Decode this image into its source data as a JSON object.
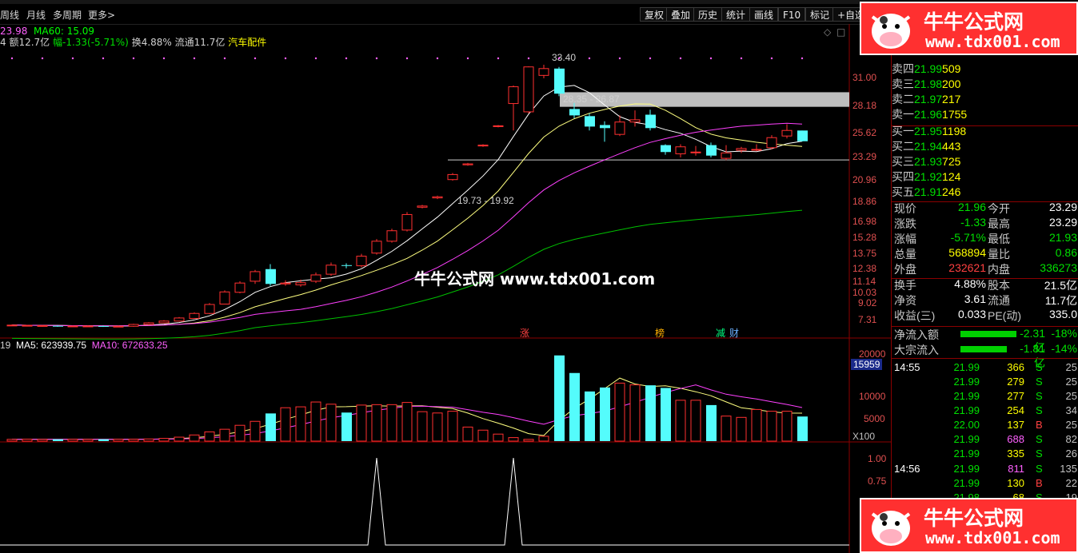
{
  "toolbar": {
    "left_items": [
      "周线",
      "月线",
      "多周期",
      "更多>"
    ],
    "buttons": [
      "复权",
      "叠加",
      "历史",
      "统计",
      "画线",
      "F10",
      "标记",
      "+自选"
    ]
  },
  "info": {
    "ma_values": [
      {
        "label": "23.98",
        "color": "#ff60ff"
      },
      {
        "label": "MA60: 15.09",
        "color": "#00ff00"
      }
    ],
    "line2": [
      {
        "text": "4 额12.7亿",
        "color": "#d0d0d0"
      },
      {
        "text": "幅-1.33(-5.71%)",
        "color": "#00e000"
      },
      {
        "text": "换4.88%",
        "color": "#d0d0d0"
      },
      {
        "text": "流通11.7亿",
        "color": "#d0d0d0"
      },
      {
        "text": "汽车配件",
        "color": "#ffff00"
      }
    ]
  },
  "price_axis": [
    "31.00",
    "28.18",
    "25.62",
    "23.29",
    "20.96",
    "18.86",
    "16.98",
    "15.28",
    "13.75",
    "12.38",
    "11.14",
    "10.03",
    "9.02",
    "7.31"
  ],
  "annotations": {
    "high": "33.40",
    "band1": "28.35 - 26.87",
    "band2": "19.73 - 19.92",
    "tags": [
      {
        "text": "涨",
        "color": "#ff4040"
      },
      {
        "text": "榜",
        "color": "#ffb000"
      },
      {
        "text": "减",
        "color": "#00ff80"
      },
      {
        "text": "财",
        "color": "#6ab0ff"
      }
    ]
  },
  "volume": {
    "header": [
      {
        "text": "19",
        "color": "#d0d0d0"
      },
      {
        "text": "MA5: 623939.75",
        "color": "#ffffff"
      },
      {
        "text": "MA10: 672633.25",
        "color": "#ff60ff"
      }
    ],
    "axis": [
      "20000",
      "15959",
      "10000",
      "5000",
      "X100"
    ],
    "highlight_value": "15959"
  },
  "indicator": {
    "axis": [
      "1.00",
      "0.75"
    ]
  },
  "watermark": {
    "center": "牛牛公式网 www.tdx001.com",
    "badge_title": "牛牛公式网",
    "badge_url": "www.tdx001.com"
  },
  "quote": {
    "asks": [
      {
        "label": "卖四",
        "price": "21.99",
        "vol": "509"
      },
      {
        "label": "卖三",
        "price": "21.98",
        "vol": "200"
      },
      {
        "label": "卖二",
        "price": "21.97",
        "vol": "217"
      },
      {
        "label": "卖一",
        "price": "21.96",
        "vol": "1755"
      }
    ],
    "bids": [
      {
        "label": "买一",
        "price": "21.95",
        "vol": "1198"
      },
      {
        "label": "买二",
        "price": "21.94",
        "vol": "443"
      },
      {
        "label": "买三",
        "price": "21.93",
        "vol": "725"
      },
      {
        "label": "买四",
        "price": "21.92",
        "vol": "124"
      },
      {
        "label": "买五",
        "price": "21.91",
        "vol": "246"
      }
    ],
    "stats": [
      {
        "l1": "现价",
        "v1": "21.96",
        "c1": "#00e000",
        "l2": "今开",
        "v2": "23.29",
        "c2": "#ffffff"
      },
      {
        "l1": "涨跌",
        "v1": "-1.33",
        "c1": "#00e000",
        "l2": "最高",
        "v2": "23.29",
        "c2": "#ffffff"
      },
      {
        "l1": "涨幅",
        "v1": "-5.71%",
        "c1": "#00e000",
        "l2": "最低",
        "v2": "21.93",
        "c2": "#00e000"
      },
      {
        "l1": "总量",
        "v1": "568894",
        "c1": "#ffff00",
        "l2": "量比",
        "v2": "0.86",
        "c2": "#00e000"
      },
      {
        "l1": "外盘",
        "v1": "232621",
        "c1": "#ff4040",
        "l2": "内盘",
        "v2": "336273",
        "c2": "#00e000"
      }
    ],
    "fund": [
      {
        "l1": "换手",
        "v1": "4.88%",
        "l2": "股本",
        "v2": "21.5亿"
      },
      {
        "l1": "净资",
        "v1": "3.61",
        "l2": "流通",
        "v2": "11.7亿"
      },
      {
        "l1": "收益(三)",
        "v1": "0.033",
        "l2": "PE(动)",
        "v2": "335.0"
      }
    ],
    "flows": [
      {
        "label": "净流入额",
        "value": "-2.31亿",
        "pct": "-18%"
      },
      {
        "label": "大宗流入",
        "value": "-1.81亿",
        "pct": "-14%"
      }
    ],
    "ticks": [
      {
        "time": "14:55",
        "price": "21.99",
        "vol": "366",
        "bs": "S",
        "n": "25",
        "pc": "#00e000",
        "vc": "#ffff00"
      },
      {
        "time": "",
        "price": "21.99",
        "vol": "279",
        "bs": "S",
        "n": "25",
        "pc": "#00e000",
        "vc": "#ffff00"
      },
      {
        "time": "",
        "price": "21.99",
        "vol": "277",
        "bs": "S",
        "n": "25",
        "pc": "#00e000",
        "vc": "#ffff00"
      },
      {
        "time": "",
        "price": "21.99",
        "vol": "254",
        "bs": "S",
        "n": "34",
        "pc": "#00e000",
        "vc": "#ffff00"
      },
      {
        "time": "",
        "price": "22.00",
        "vol": "137",
        "bs": "B",
        "n": "25",
        "pc": "#00e000",
        "vc": "#ffff00"
      },
      {
        "time": "",
        "price": "21.99",
        "vol": "688",
        "bs": "S",
        "n": "82",
        "pc": "#00e000",
        "vc": "#ff60ff"
      },
      {
        "time": "",
        "price": "21.99",
        "vol": "335",
        "bs": "S",
        "n": "26",
        "pc": "#00e000",
        "vc": "#ffff00"
      },
      {
        "time": "14:56",
        "price": "21.99",
        "vol": "811",
        "bs": "S",
        "n": "135",
        "pc": "#00e000",
        "vc": "#ff60ff"
      },
      {
        "time": "",
        "price": "21.99",
        "vol": "130",
        "bs": "B",
        "n": "22",
        "pc": "#00e000",
        "vc": "#ffff00"
      },
      {
        "time": "",
        "price": "21.98",
        "vol": "68",
        "bs": "S",
        "n": "19",
        "pc": "#00e000",
        "vc": "#ffff00"
      }
    ]
  },
  "chart_data": {
    "type": "candlestick",
    "price_scale": "log",
    "ylim": [
      7.31,
      33.4
    ],
    "candles": [
      [
        8.02,
        8.02,
        8.05,
        7.99
      ],
      [
        8.0,
        8.01,
        8.03,
        7.97
      ],
      [
        7.98,
        8.0,
        8.02,
        7.95
      ],
      [
        7.99,
        7.98,
        8.01,
        7.95
      ],
      [
        7.97,
        7.98,
        8.0,
        7.94
      ],
      [
        7.98,
        7.98,
        8.01,
        7.95
      ],
      [
        7.98,
        7.97,
        8.0,
        7.94
      ],
      [
        7.97,
        7.97,
        8.0,
        7.93
      ],
      [
        7.97,
        8.05,
        8.08,
        7.95
      ],
      [
        8.05,
        8.12,
        8.15,
        8.02
      ],
      [
        8.12,
        8.2,
        8.24,
        8.1
      ],
      [
        8.2,
        8.34,
        8.38,
        8.18
      ],
      [
        8.32,
        8.55,
        8.6,
        8.3
      ],
      [
        8.55,
        8.98,
        9.05,
        8.52
      ],
      [
        9.0,
        9.62,
        9.7,
        8.98
      ],
      [
        9.6,
        10.1,
        10.2,
        9.55
      ],
      [
        10.2,
        10.75,
        10.85,
        10.05
      ],
      [
        10.9,
        10.05,
        11.2,
        9.95
      ],
      [
        10.05,
        10.1,
        10.25,
        9.95
      ],
      [
        10.0,
        10.12,
        10.3,
        9.9
      ],
      [
        10.2,
        10.56,
        10.7,
        10.1
      ],
      [
        10.6,
        11.14,
        11.3,
        10.5
      ],
      [
        11.14,
        11.1,
        11.25,
        10.95
      ],
      [
        11.1,
        11.7,
        11.85,
        11.0
      ],
      [
        11.9,
        12.7,
        12.85,
        11.8
      ],
      [
        12.7,
        13.45,
        13.6,
        12.6
      ],
      [
        13.5,
        14.7,
        14.9,
        13.4
      ],
      [
        15.3,
        15.4,
        15.5,
        15.2
      ],
      [
        16.1,
        16.2,
        16.3,
        16.0
      ],
      [
        17.8,
        18.3,
        18.45,
        17.7
      ],
      [
        19.3,
        19.4,
        19.5,
        19.2
      ],
      [
        21.4,
        21.5,
        21.6,
        21.3
      ],
      [
        23.8,
        23.9,
        24.0,
        23.7
      ],
      [
        27.0,
        29.6,
        29.8,
        23.3
      ],
      [
        25.8,
        33.0,
        33.1,
        25.6
      ],
      [
        31.5,
        32.7,
        33.4,
        31.0
      ],
      [
        32.7,
        28.5,
        33.0,
        28.1
      ],
      [
        26.2,
        25.3,
        27.1,
        24.9
      ],
      [
        25.2,
        23.8,
        25.6,
        23.3
      ],
      [
        24.0,
        23.6,
        24.5,
        21.9
      ],
      [
        22.8,
        24.4,
        25.3,
        22.6
      ],
      [
        24.4,
        24.7,
        26.0,
        23.8
      ],
      [
        25.4,
        23.6,
        26.1,
        23.3
      ],
      [
        21.5,
        20.7,
        21.6,
        20.4
      ],
      [
        20.5,
        21.3,
        21.6,
        20.1
      ],
      [
        20.7,
        20.7,
        21.4,
        20.3
      ],
      [
        21.5,
        20.3,
        21.8,
        20.1
      ],
      [
        20.0,
        20.6,
        21.5,
        19.8
      ],
      [
        20.9,
        21.1,
        21.3,
        20.6
      ],
      [
        20.95,
        21.0,
        21.6,
        20.8
      ],
      [
        21.2,
        22.4,
        22.7,
        21.0
      ],
      [
        22.6,
        23.3,
        24.1,
        22.3
      ],
      [
        23.29,
        21.96,
        23.29,
        21.93
      ]
    ],
    "volume_x100": [
      400,
      450,
      400,
      420,
      430,
      410,
      420,
      430,
      440,
      500,
      620,
      900,
      1400,
      2100,
      2700,
      3600,
      4500,
      6300,
      7600,
      7800,
      8900,
      8400,
      6500,
      8200,
      8300,
      8300,
      8800,
      6700,
      6400,
      6800,
      3200,
      2500,
      1600,
      800,
      400,
      1100,
      19500,
      15500,
      11300,
      12200,
      13200,
      12800,
      12700,
      12100,
      9300,
      9300,
      8200,
      5700,
      5400,
      7200,
      6800,
      6800,
      5600
    ],
    "indicator_peaks": [
      24,
      33
    ]
  }
}
